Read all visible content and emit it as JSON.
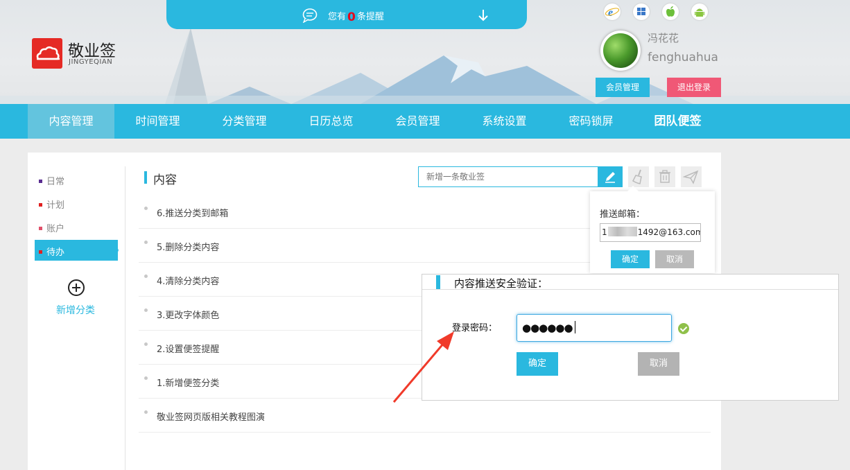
{
  "header": {
    "notice": {
      "prefix": "您有",
      "count": "0",
      "suffix": "条提醒"
    },
    "logo": {
      "name": "敬业签",
      "subtitle": "JINGYEQIAN"
    },
    "os_icons": [
      "ie-icon",
      "windows-icon",
      "apple-icon",
      "android-icon"
    ],
    "user": {
      "display_name": "冯花花",
      "username": "fenghuahua"
    },
    "member_button": "会员管理",
    "logout_button": "退出登录"
  },
  "nav": {
    "items": [
      "内容管理",
      "时间管理",
      "分类管理",
      "日历总览",
      "会员管理",
      "系统设置",
      "密码锁屏",
      "团队便签"
    ],
    "active_index": 0
  },
  "sidebar": {
    "categories": [
      {
        "label": "日常",
        "color": "#5a2d91"
      },
      {
        "label": "计划",
        "color": "#e02020"
      },
      {
        "label": "账户",
        "color": "#e0506a"
      },
      {
        "label": "待办",
        "color": "#e02020"
      }
    ],
    "active_index": 3,
    "add_label": "新增分类"
  },
  "content": {
    "title": "内容",
    "new_placeholder": "新增一条敬业签",
    "items": [
      "6.推送分类到邮箱",
      "5.删除分类内容",
      "4.清除分类内容",
      "3.更改字体颜色",
      "2.设置便签提醒",
      "1.新增便签分类",
      "敬业签网页版相关教程图演"
    ]
  },
  "push_panel": {
    "label": "推送邮箱：",
    "email_prefix": "1",
    "email_suffix": "1492@163.com",
    "ok": "确定",
    "cancel": "取消"
  },
  "dialog": {
    "title": "内容推送安全验证：",
    "password_label": "登录密码：",
    "password_value": "●●●●●●",
    "ok": "确定",
    "cancel": "取消"
  },
  "colors": {
    "accent": "#2ab8df",
    "logout": "#f05876",
    "logo": "#e52a25",
    "annotation_arrow": "#f03a2a"
  }
}
